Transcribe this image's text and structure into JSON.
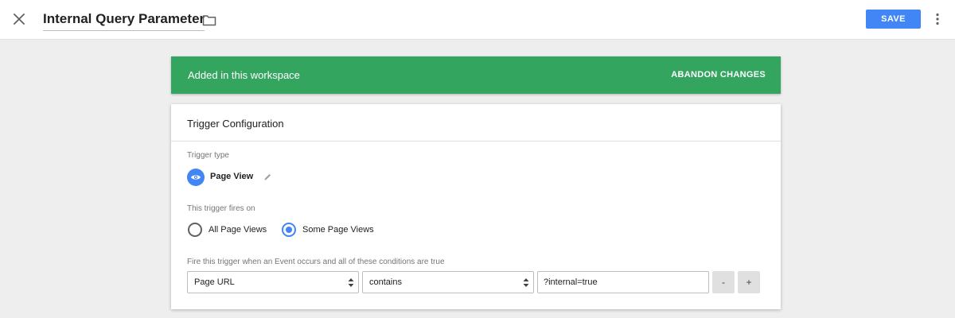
{
  "header": {
    "title": "Internal Query Parameter",
    "save_label": "SAVE",
    "icons": {
      "close": "close-icon",
      "folder": "folder-icon",
      "more": "more-vert-icon"
    }
  },
  "banner": {
    "text": "Added in this workspace",
    "action_label": "ABANDON CHANGES",
    "color": "#33a55f"
  },
  "card": {
    "title": "Trigger Configuration",
    "trigger_type": {
      "label": "Trigger type",
      "value": "Page View",
      "icon": "eye-icon",
      "icon_color": "#4285f4"
    },
    "fires_on": {
      "label": "This trigger fires on",
      "options": [
        "All Page Views",
        "Some Page Views"
      ],
      "selected": "Some Page Views"
    },
    "conditions": {
      "label": "Fire this trigger when an Event occurs and all of these conditions are true",
      "variable": "Page URL",
      "operator": "contains",
      "value": "?internal=true",
      "remove_label": "-",
      "add_label": "+"
    }
  },
  "colors": {
    "accent": "#4285f4",
    "background": "#eeeeee"
  }
}
